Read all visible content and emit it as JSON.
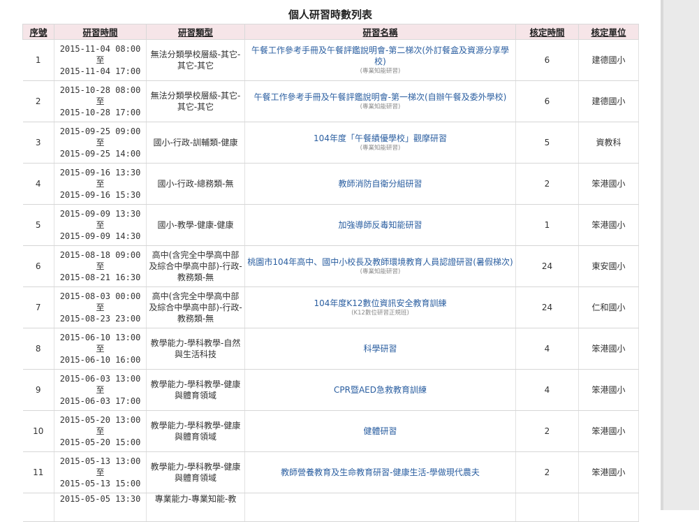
{
  "page_title": "個人研習時數列表",
  "columns": [
    "序號",
    "研習時間",
    "研習類型",
    "研習名稱",
    "核定時間",
    "核定單位"
  ],
  "time_sep": "至",
  "rows": [
    {
      "seq": "1",
      "start": "2015-11-04 08:00",
      "end": "2015-11-04 17:00",
      "category": "無法分類學校層級-其它-其它-其它",
      "name": "午餐工作參考手冊及午餐評鑑說明會-第二梯次(外訂餐盒及資源分享學校)",
      "type": "(專業知能研習)",
      "hours": "6",
      "unit": "建德國小"
    },
    {
      "seq": "2",
      "start": "2015-10-28 08:00",
      "end": "2015-10-28 17:00",
      "category": "無法分類學校層級-其它-其它-其它",
      "name": "午餐工作參考手冊及午餐評鑑說明會-第一梯次(自辦午餐及委外學校)",
      "type": "(專業知能研習)",
      "hours": "6",
      "unit": "建德國小"
    },
    {
      "seq": "3",
      "start": "2015-09-25 09:00",
      "end": "2015-09-25 14:00",
      "category": "國小-行政-訓輔類-健康",
      "name": "104年度「午餐績優學校」觀摩研習",
      "type": "(專業知能研習)",
      "hours": "5",
      "unit": "資教科"
    },
    {
      "seq": "4",
      "start": "2015-09-16 13:30",
      "end": "2015-09-16 15:30",
      "category": "國小-行政-總務類-無",
      "name": "教師消防自衛分組研習",
      "type": "",
      "hours": "2",
      "unit": "笨港國小"
    },
    {
      "seq": "5",
      "start": "2015-09-09 13:30",
      "end": "2015-09-09 14:30",
      "category": "國小-教學-健康-健康",
      "name": "加強導師反毒知能研習",
      "type": "",
      "hours": "1",
      "unit": "笨港國小"
    },
    {
      "seq": "6",
      "start": "2015-08-18 09:00",
      "end": "2015-08-21 16:30",
      "category": "高中(含完全中學高中部及綜合中學高中部)-行政-教務類-無",
      "name": "桃園市104年高中、國中小校長及教師環境教育人員認證研習(暑假梯次)",
      "type": "(專業知能研習)",
      "hours": "24",
      "unit": "東安國小"
    },
    {
      "seq": "7",
      "start": "2015-08-03 00:00",
      "end": "2015-08-23 23:00",
      "category": "高中(含完全中學高中部及綜合中學高中部)-行政-教務類-無",
      "name": "104年度K12數位資訊安全教育訓練",
      "type": "(K12數位研習正規班)",
      "hours": "24",
      "unit": "仁和國小"
    },
    {
      "seq": "8",
      "start": "2015-06-10 13:00",
      "end": "2015-06-10 16:00",
      "category": "教學能力-學科教學-自然與生活科技",
      "name": "科學研習",
      "type": "",
      "hours": "4",
      "unit": "笨港國小"
    },
    {
      "seq": "9",
      "start": "2015-06-03 13:00",
      "end": "2015-06-03 17:00",
      "category": "教學能力-學科教學-健康與體育領域",
      "name": "CPR暨AED急救教育訓練",
      "type": "",
      "hours": "4",
      "unit": "笨港國小"
    },
    {
      "seq": "10",
      "start": "2015-05-20 13:00",
      "end": "2015-05-20 15:00",
      "category": "教學能力-學科教學-健康與體育領域",
      "name": "健體研習",
      "type": "",
      "hours": "2",
      "unit": "笨港國小"
    },
    {
      "seq": "11",
      "start": "2015-05-13 13:00",
      "end": "2015-05-13 15:00",
      "category": "教學能力-學科教學-健康與體育領域",
      "name": "教師營養教育及生命教育研習-健康生活-學做現代農夫",
      "type": "",
      "hours": "2",
      "unit": "笨港國小"
    },
    {
      "seq": "",
      "start": "2015-05-05 13:30",
      "end": "",
      "category": "專業能力-專業知能-教",
      "name": "",
      "type": "",
      "hours": "",
      "unit": ""
    }
  ]
}
